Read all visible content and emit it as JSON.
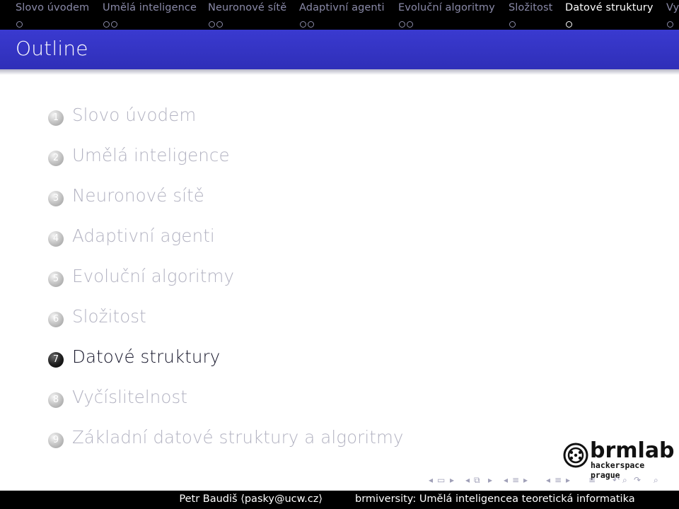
{
  "nav": {
    "sections": [
      {
        "label": "Slovo úvodem",
        "dots": 1,
        "active": false
      },
      {
        "label": "Umělá inteligence",
        "dots": 2,
        "active": false
      },
      {
        "label": "Neuronové sítě",
        "dots": 2,
        "active": false
      },
      {
        "label": "Adaptivní agenti",
        "dots": 2,
        "active": false
      },
      {
        "label": "Evoluční algoritmy",
        "dots": 2,
        "active": false
      },
      {
        "label": "Složitost",
        "dots": 1,
        "active": false
      },
      {
        "label": "Datové struktury",
        "dots": 1,
        "active": true
      },
      {
        "label": "Vy",
        "dots": 1,
        "active": false
      }
    ]
  },
  "frame": {
    "title": "Outline"
  },
  "outline": {
    "items": [
      {
        "number": "1",
        "label": "Slovo úvodem",
        "active": false
      },
      {
        "number": "2",
        "label": "Umělá inteligence",
        "active": false
      },
      {
        "number": "3",
        "label": "Neuronové sítě",
        "active": false
      },
      {
        "number": "4",
        "label": "Adaptivní agenti",
        "active": false
      },
      {
        "number": "5",
        "label": "Evoluční algoritmy",
        "active": false
      },
      {
        "number": "6",
        "label": "Složitost",
        "active": false
      },
      {
        "number": "7",
        "label": "Datové struktury",
        "active": true
      },
      {
        "number": "8",
        "label": "Vyčíslitelnost",
        "active": false
      },
      {
        "number": "9",
        "label": "Základní datové struktury a algoritmy",
        "active": false
      }
    ]
  },
  "logo": {
    "main": "brmlab",
    "sub": "hackerspace prague"
  },
  "footer": {
    "author": "Petr Baudiš ⟨pasky@ucw.cz⟩",
    "title": "brmiversity: Umělá inteligencea teoretická informatika"
  },
  "colors": {
    "title_band": "#3434c8",
    "nav_inactive": "#8a8aa8",
    "nav_active": "#ffffff",
    "outline_inactive": "#b3b3c2",
    "outline_active": "#1a1a2e"
  }
}
